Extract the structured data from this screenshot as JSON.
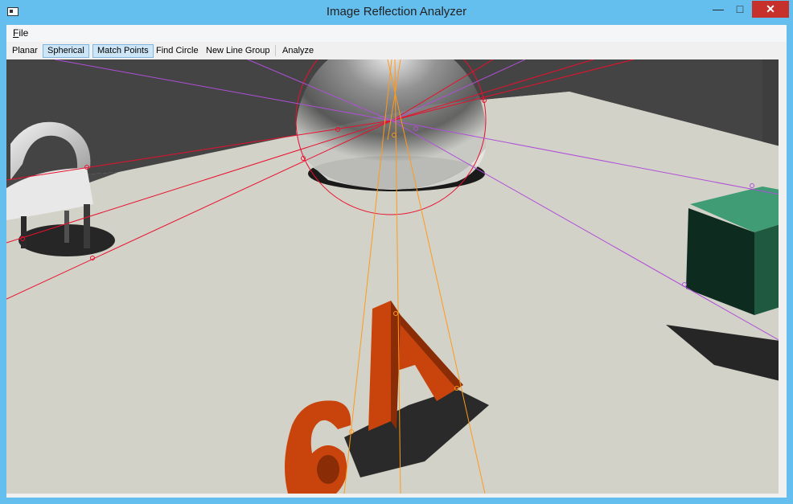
{
  "window": {
    "title": "Image Reflection Analyzer",
    "minimize_glyph": "—",
    "maximize_glyph": "□",
    "close_glyph": "✕"
  },
  "menu": {
    "file_first_letter": "F",
    "file_rest": "ile"
  },
  "toolbar": {
    "planar": "Planar",
    "spherical": "Spherical",
    "match_points": "Match Points",
    "find_circle": "Find Circle",
    "new_line_group": "New Line Group",
    "analyze": "Analyze"
  },
  "scene": {
    "letter_big": "A",
    "letter_small": "6"
  },
  "colors": {
    "titlebar": "#65bfee",
    "close_button": "#c7312b",
    "red_lines": "#e8102e",
    "purple_lines": "#b04fd8",
    "orange_lines": "#ff9a1a",
    "floor": "#d3d2c8",
    "background_wall": "#444444",
    "letters": "#c8440c",
    "cube": "#2b6b4a"
  }
}
